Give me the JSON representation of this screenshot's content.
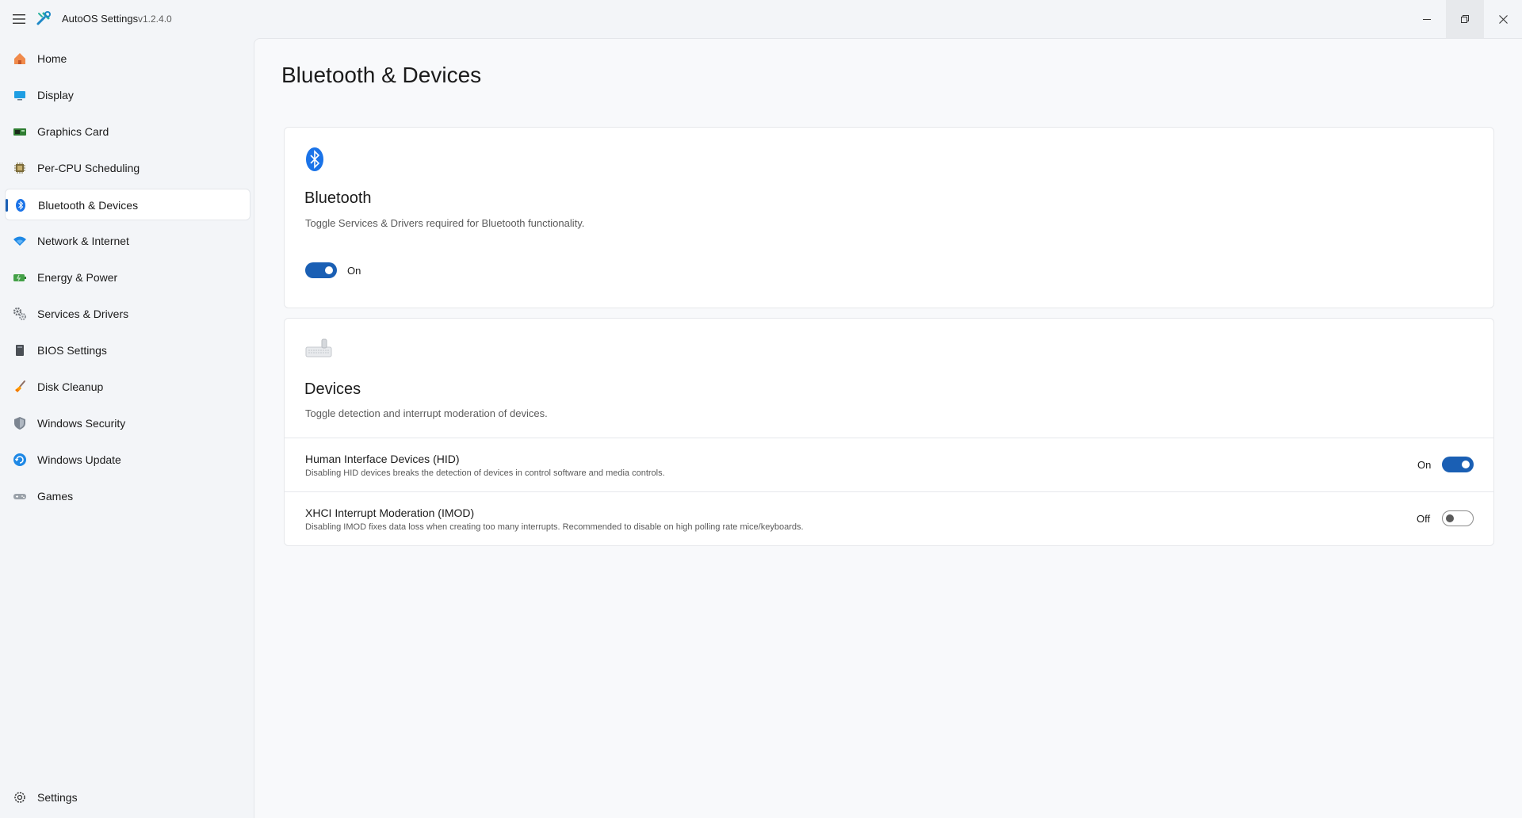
{
  "titlebar": {
    "title": "AutoOS Settings",
    "version": "v1.2.4.0",
    "icons": {
      "menu": "hamburger-icon",
      "logo": "autoos-logo",
      "minimize": "minimize-icon",
      "restore": "restore-icon",
      "close": "close-icon"
    }
  },
  "sidebar": {
    "items": [
      {
        "label": "Home",
        "icon": "home-icon"
      },
      {
        "label": "Display",
        "icon": "display-icon"
      },
      {
        "label": "Graphics Card",
        "icon": "graphics-card-icon"
      },
      {
        "label": "Per-CPU Scheduling",
        "icon": "cpu-icon"
      },
      {
        "label": "Bluetooth & Devices",
        "icon": "bluetooth-icon",
        "active": true
      },
      {
        "label": "Network & Internet",
        "icon": "wifi-icon"
      },
      {
        "label": "Energy & Power",
        "icon": "battery-icon"
      },
      {
        "label": "Services & Drivers",
        "icon": "gears-icon"
      },
      {
        "label": "BIOS Settings",
        "icon": "chip-icon"
      },
      {
        "label": "Disk Cleanup",
        "icon": "broom-icon"
      },
      {
        "label": "Windows Security",
        "icon": "shield-icon"
      },
      {
        "label": "Windows Update",
        "icon": "update-icon"
      },
      {
        "label": "Games",
        "icon": "gamepad-icon"
      }
    ],
    "footer": {
      "label": "Settings",
      "icon": "gear-icon"
    }
  },
  "page": {
    "title": "Bluetooth & Devices",
    "bluetooth": {
      "title": "Bluetooth",
      "description": "Toggle Services & Drivers required for Bluetooth functionality.",
      "toggle_state": "On",
      "enabled": true
    },
    "devices": {
      "title": "Devices",
      "description": "Toggle detection and interrupt moderation of devices.",
      "rows": [
        {
          "title": "Human Interface Devices (HID)",
          "description": "Disabling HID devices breaks the detection of devices in control software and media controls.",
          "state": "On",
          "enabled": true
        },
        {
          "title": "XHCI Interrupt Moderation (IMOD)",
          "description": "Disabling IMOD fixes data loss when creating too many interrupts. Recommended to disable on high polling rate mice/keyboards.",
          "state": "Off",
          "enabled": false
        }
      ]
    }
  },
  "colors": {
    "accent": "#1a5fb4",
    "background": "#f3f5f8",
    "card": "#ffffff"
  }
}
